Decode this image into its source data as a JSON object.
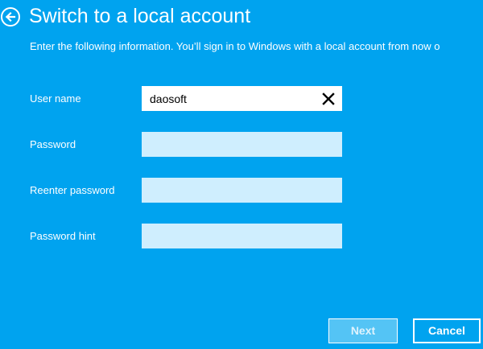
{
  "page": {
    "title": "Switch to a local account",
    "subtitle": "Enter the following information. You’ll sign in to Windows with a local account from now o",
    "back_icon": "back-arrow-icon"
  },
  "form": {
    "username": {
      "label": "User name",
      "value": "daosoft"
    },
    "password": {
      "label": "Password",
      "value": ""
    },
    "reenter_password": {
      "label": "Reenter password",
      "value": ""
    },
    "password_hint": {
      "label": "Password hint",
      "value": ""
    },
    "clear_icon": "close-x-icon"
  },
  "buttons": {
    "next_label": "Next",
    "cancel_label": "Cancel"
  },
  "colors": {
    "background": "#00a3ef",
    "field_background": "#cfeefe",
    "active_field": "#ffffff"
  }
}
